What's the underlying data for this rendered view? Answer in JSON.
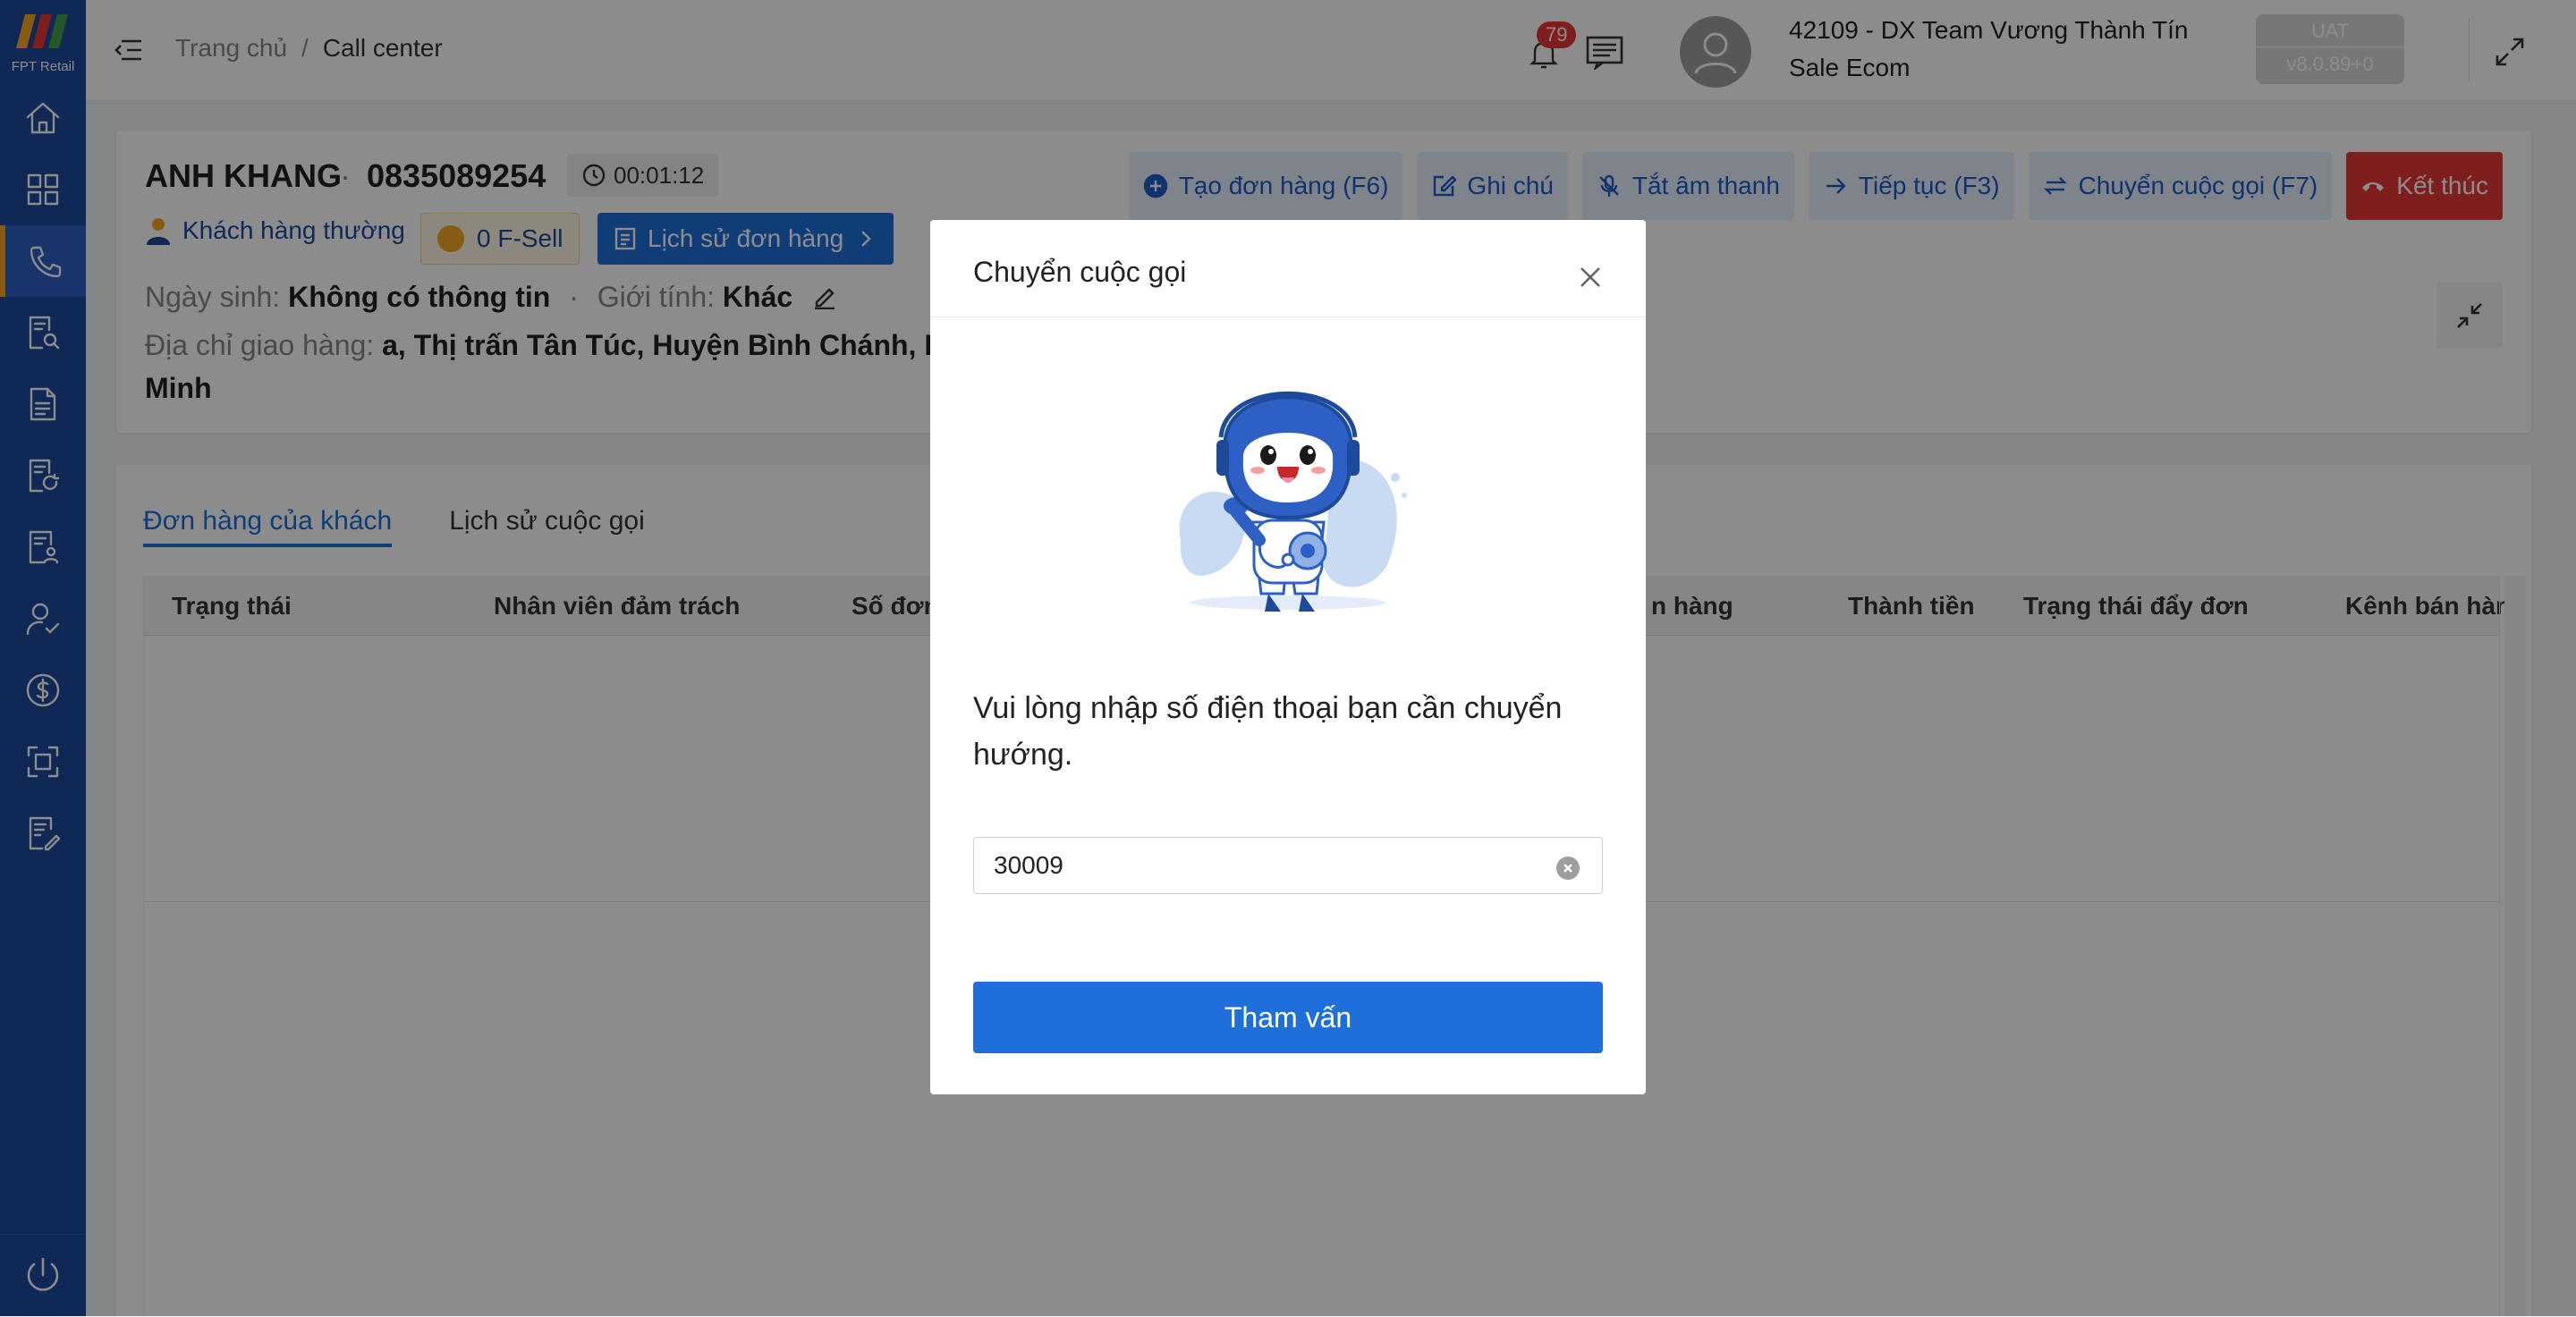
{
  "brand": {
    "logo_text": "FPT Retail"
  },
  "header": {
    "breadcrumb": [
      "Trang chủ",
      "Call center"
    ],
    "notifications_count": "79",
    "user_name": "42109 - DX Team Vương Thành Tín",
    "user_role": "Sale Ecom",
    "env": "UAT",
    "version": "v8.0.89+0"
  },
  "customer": {
    "name": "ANH KHANG",
    "phone": "0835089254",
    "call_timer": "00:01:12",
    "tier": "Khách hàng thường",
    "fsell": "0 F-Sell",
    "order_history_label": "Lịch sử đơn hàng",
    "dob_label": "Ngày sinh:",
    "dob_value": "Không có thông tin",
    "gender_label": "Giới tính:",
    "gender_value": "Khác",
    "address_label": "Địa chỉ giao hàng:",
    "address_value": "a, Thị trấn Tân Túc, Huyện Bình Chánh, Hồ C",
    "address_value_line2": "Minh"
  },
  "actions": {
    "create_order": "Tạo đơn hàng (F6)",
    "note": "Ghi chú",
    "mute": "Tắt âm thanh",
    "continue": "Tiếp tục (F3)",
    "transfer": "Chuyển cuộc gọi (F7)",
    "end": "Kết thúc"
  },
  "tabs": [
    "Đơn hàng của khách",
    "Lịch sử cuộc gọi"
  ],
  "table": {
    "columns": [
      "Trạng thái",
      "Nhân viên đảm trách",
      "Số đơn",
      "n hàng",
      "Thành tiền",
      "Trạng thái đẩy đơn",
      "Kênh bán hàng"
    ]
  },
  "modal": {
    "title": "Chuyển cuộc gọi",
    "message": "Vui lòng nhập số điện thoại bạn cần chuyển hướng.",
    "input_value": "30009",
    "button": "Tham vấn"
  },
  "colors": {
    "sidebar": "#1e4a9c",
    "primary": "#1e6fd9",
    "danger": "#e53935",
    "accent": "#f6a623"
  }
}
